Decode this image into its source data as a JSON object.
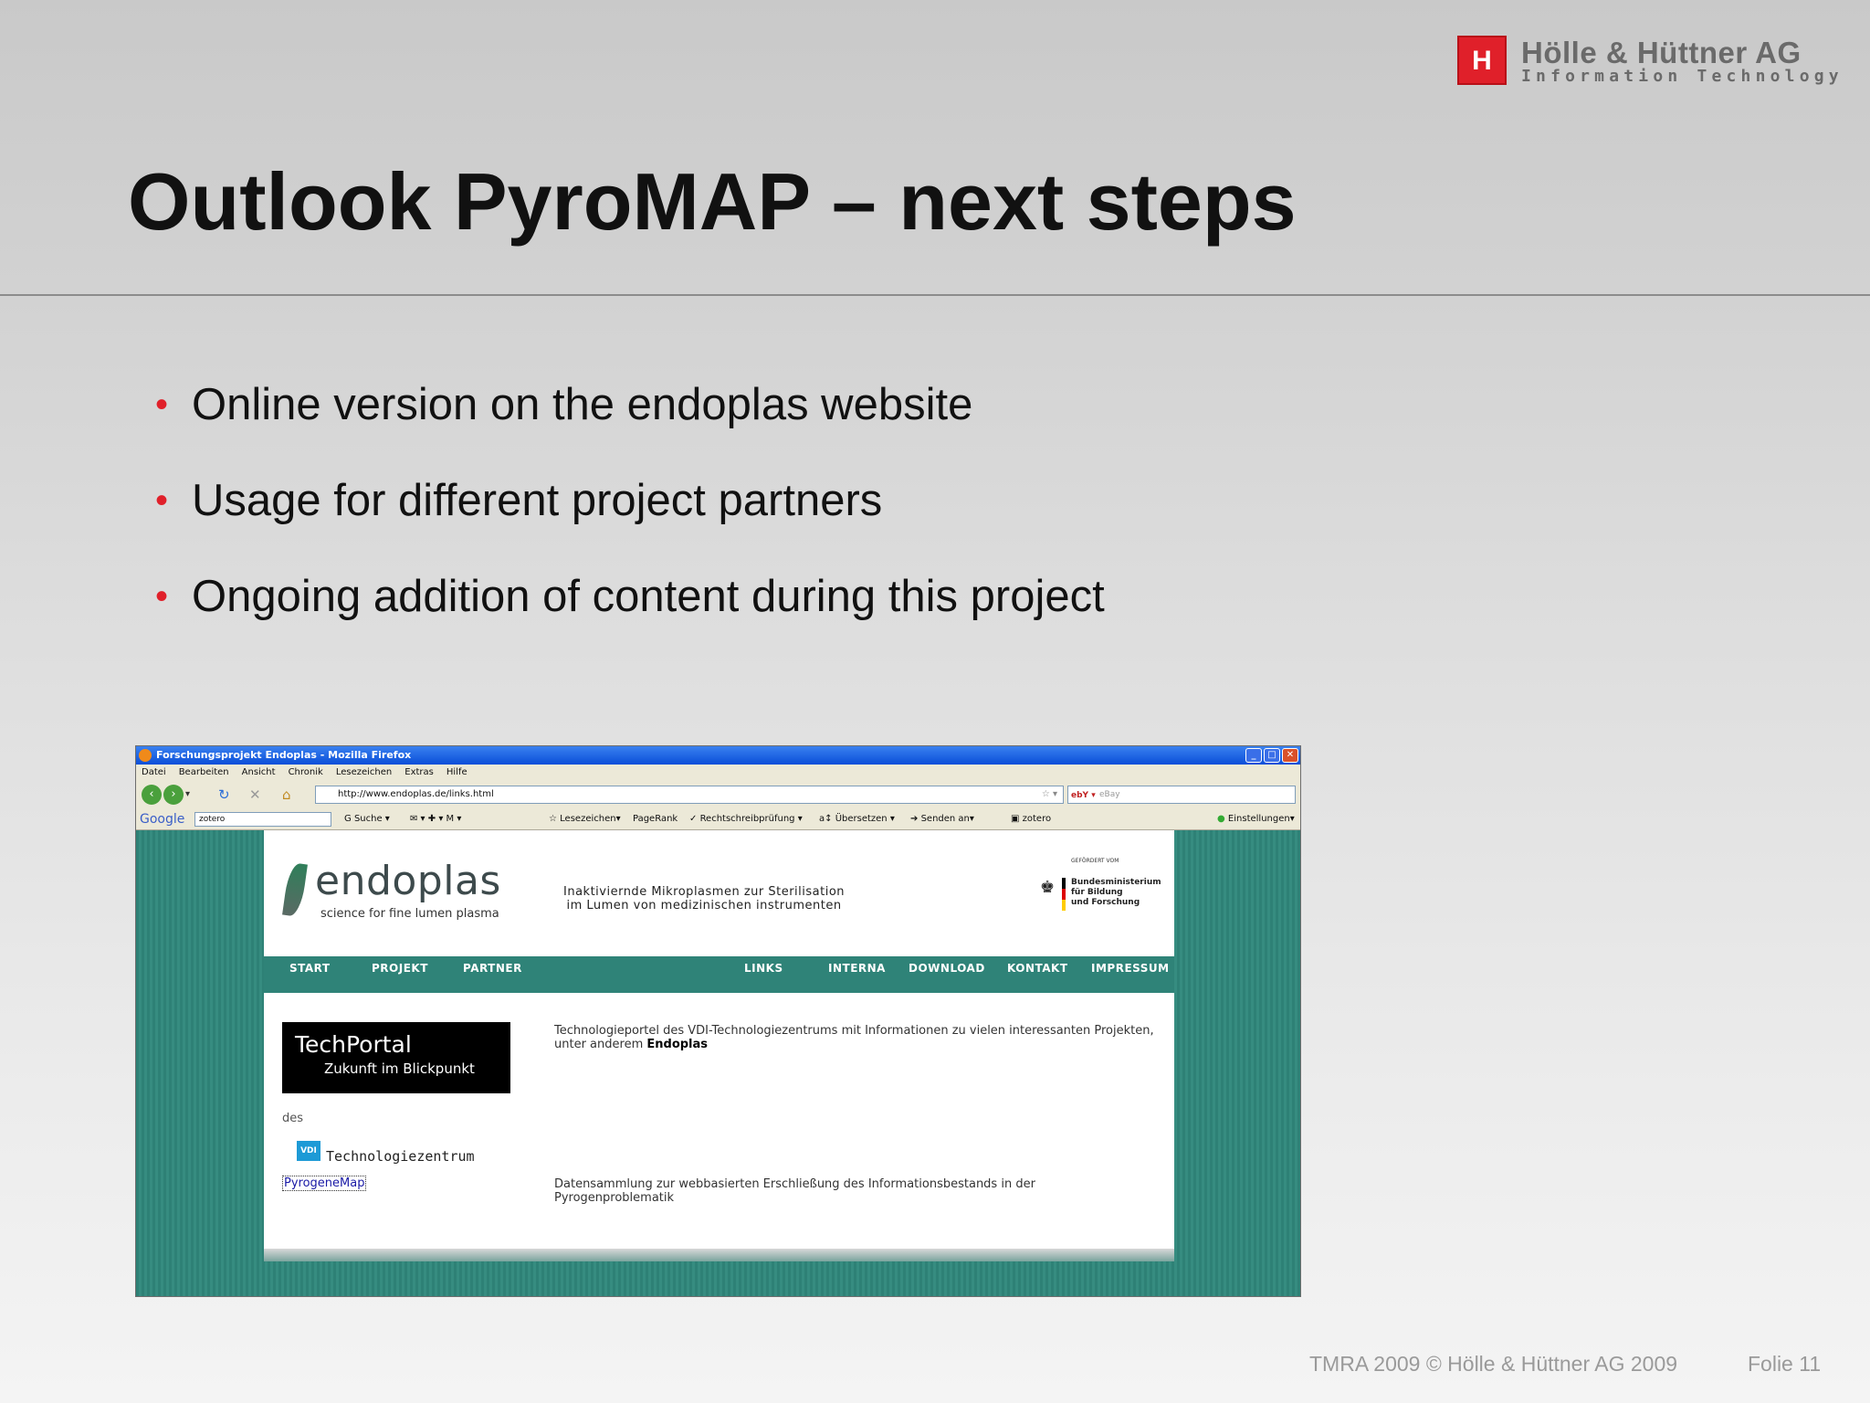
{
  "logo": {
    "mark": "H",
    "name": "Hölle & Hüttner AG",
    "sub": "Information Technology"
  },
  "title": "Outlook PyroMAP – next steps",
  "bullets": [
    "Online version on the endoplas website",
    "Usage for different project partners",
    "Ongoing addition of content during this project"
  ],
  "footer": {
    "copyright": "TMRA 2009 © Hölle & Hüttner AG 2009",
    "slide": "Folie 11"
  },
  "browser": {
    "window_title": "Forschungsprojekt Endoplas - Mozilla Firefox",
    "menu": [
      "Datei",
      "Bearbeiten",
      "Ansicht",
      "Chronik",
      "Lesezeichen",
      "Extras",
      "Hilfe"
    ],
    "url": "http://www.endoplas.de/links.html",
    "search_placeholder": "eBay",
    "google_logo": "Google",
    "google_query": "zotero",
    "toolbar_items": {
      "suche": "Suche",
      "lesezeichen": "Lesezeichen",
      "pagerank": "PageRank",
      "rechtschreib": "Rechtschreibprüfung",
      "uebersetzen": "Übersetzen",
      "senden": "Senden an",
      "zotero": "zotero",
      "einstellungen": "Einstellungen"
    },
    "site": {
      "brand": "endoplas",
      "tagline": "science for fine lumen plasma",
      "slogan_line1": "Inaktiviernde Mikroplasmen zur Sterilisation",
      "slogan_line2": "im Lumen von medizinischen instrumenten",
      "sponsor_top": "GEFÖRDERT VOM",
      "sponsor_line1": "Bundesministerium",
      "sponsor_line2": "für Bildung",
      "sponsor_line3": "und Forschung",
      "nav": [
        "START",
        "PROJEKT",
        "PARTNER",
        "LINKS",
        "INTERNA",
        "DOWNLOAD",
        "KONTAKT",
        "IMPRESSUM"
      ],
      "techportal_title": "TechPortal",
      "techportal_sub": "Zukunft im Blickpunkt",
      "desc1": "Technologieportel des VDI-Technologiezentrums mit Informationen zu vielen interessanten Projekten, unter anderem",
      "desc1_bold": "Endoplas",
      "des": "des",
      "vdi": "VDI",
      "vdi_text": "Technologiezentrum",
      "pyrogene_link": "PyrogeneMap",
      "desc2": "Datensammlung zur webbasierten Erschließung des Informationsbestands in der Pyrogenproblematik"
    }
  }
}
